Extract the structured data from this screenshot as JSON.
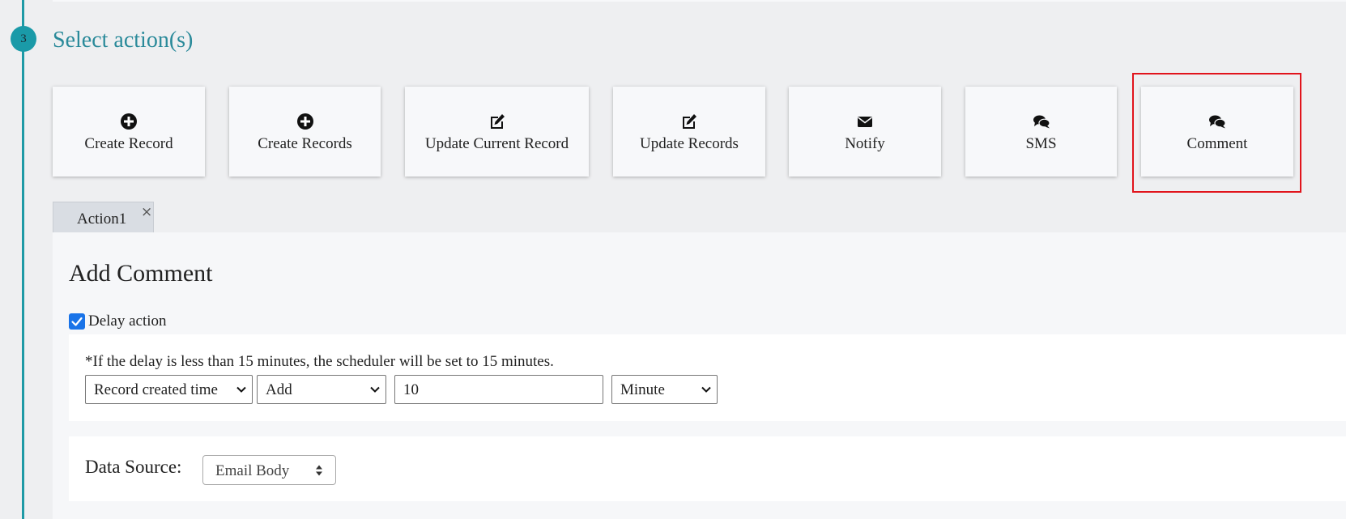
{
  "step": {
    "number": "3",
    "title": "Select action(s)"
  },
  "actions": [
    {
      "label": "Create Record",
      "icon": "plus-circle-icon"
    },
    {
      "label": "Create Records",
      "icon": "plus-circle-icon"
    },
    {
      "label": "Update Current Record",
      "icon": "edit-icon"
    },
    {
      "label": "Update Records",
      "icon": "edit-icon"
    },
    {
      "label": "Notify",
      "icon": "envelope-icon"
    },
    {
      "label": "SMS",
      "icon": "comments-icon"
    },
    {
      "label": "Comment",
      "icon": "comments-icon",
      "highlighted": true
    }
  ],
  "tabs": [
    {
      "label": "Action1",
      "close": "×"
    }
  ],
  "panel": {
    "heading": "Add Comment",
    "delay": {
      "checked": true,
      "label": "Delay action",
      "note": "*If the delay is less than 15 minutes, the scheduler will be set to 15 minutes.",
      "time_reference": "Record created time",
      "operation": "Add",
      "amount": "10",
      "unit": "Minute"
    },
    "data_source": {
      "label": "Data Source:",
      "value": "Email Body"
    }
  },
  "colors": {
    "accent": "#1e9aa6",
    "highlight": "#e1141c",
    "checkbox": "#1973e8",
    "background": "#eeeff1"
  }
}
